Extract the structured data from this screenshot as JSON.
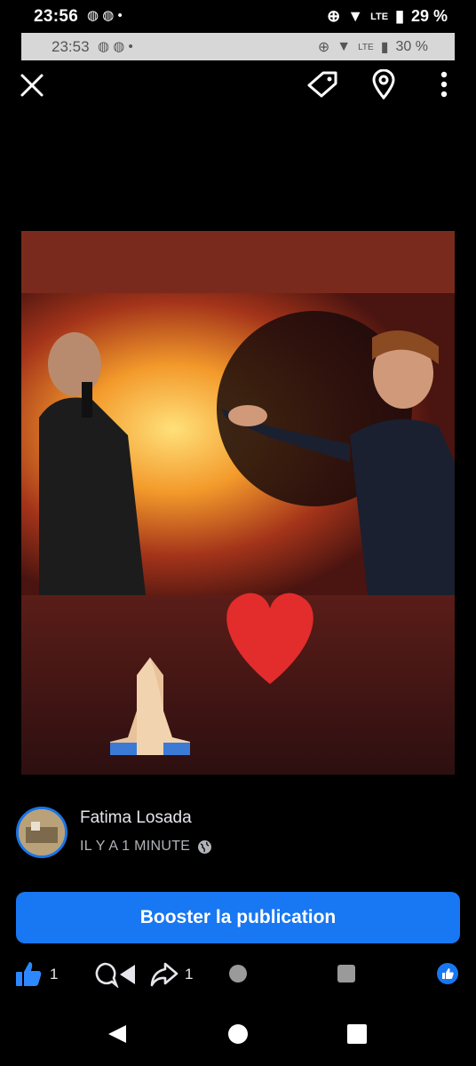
{
  "status_bar": {
    "time": "23:56",
    "battery": "29 %",
    "network": "LTE"
  },
  "inner_status_bar": {
    "time": "23:53",
    "battery": "30 %",
    "network": "LTE"
  },
  "toolbar": {
    "close_icon": "close-icon",
    "tag_icon": "tag-icon",
    "location_icon": "location-pin-icon",
    "more_icon": "more-vertical-icon"
  },
  "post": {
    "author": "Fatima Losada",
    "time_label": "IL Y A 1 MINUTE",
    "privacy_icon": "globe-icon",
    "boost_label": "Booster la publication"
  },
  "actions": {
    "like_count": "1",
    "share_count": "1"
  },
  "colors": {
    "accent": "#1877f2",
    "background": "#000000"
  }
}
